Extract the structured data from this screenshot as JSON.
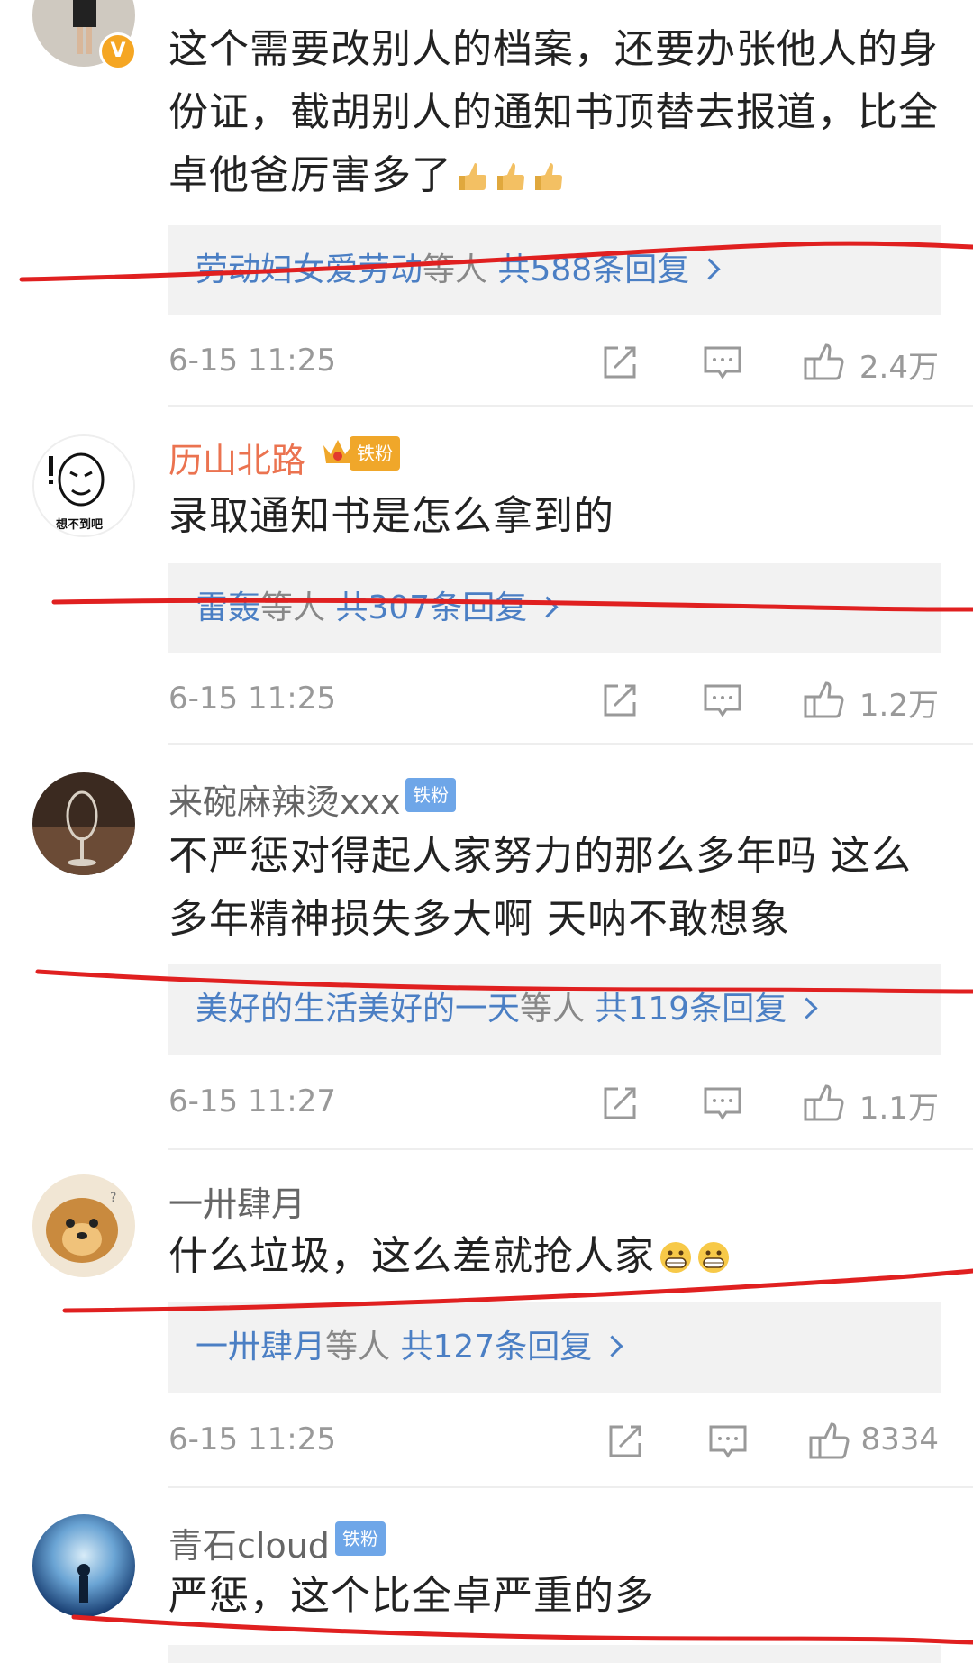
{
  "comments": [
    {
      "username": "",
      "badge": "",
      "text": "这个需要改别人的档案，还要办张他人的身份证，截胡别人的通知书顶替去报道，比全卓他爸厉害多了",
      "emoji_icon": "thumbs-up-emoji",
      "replies": {
        "names": "劳动妇女爱劳动",
        "mid": "等人",
        "count": "共588条回复"
      },
      "time": "6-15 11:25",
      "likes": "2.4万"
    },
    {
      "username": "历山北路",
      "badge": "铁粉",
      "text": "录取通知书是怎么拿到的",
      "replies": {
        "names": "雷轰",
        "mid": "等人",
        "count": "共307条回复"
      },
      "time": "6-15 11:25",
      "likes": "1.2万"
    },
    {
      "username": "来碗麻辣烫xxx",
      "badge": "铁粉",
      "text": "不严惩对得起人家努力的那么多年吗 这么多年精神损失多大啊 天呐不敢想象",
      "replies": {
        "names": "美好的生活美好的一天",
        "mid": "等人",
        "count": "共119条回复"
      },
      "time": "6-15 11:27",
      "likes": "1.1万"
    },
    {
      "username": "一卅肆月",
      "badge": "",
      "text": "什么垃圾，这么差就抢人家",
      "emoji_icon": "grin-emoji",
      "replies": {
        "names": "一卅肆月",
        "mid": "等人",
        "count": "共127条回复"
      },
      "time": "6-15 11:25",
      "likes": "8334"
    },
    {
      "username": "青石cloud",
      "badge": "铁粉",
      "text": "严惩，这个比全卓严重的多"
    }
  ],
  "verified_badge": "V",
  "avatar_caption": "想不到吧",
  "colors": {
    "link": "#4b7fc4",
    "meta": "#999999",
    "reply_bg": "#f2f2f2",
    "annotation": "#e02020",
    "orange_name": "#eb7350"
  },
  "icons": [
    "share-icon",
    "comment-icon",
    "like-icon",
    "chevron-right-icon"
  ]
}
